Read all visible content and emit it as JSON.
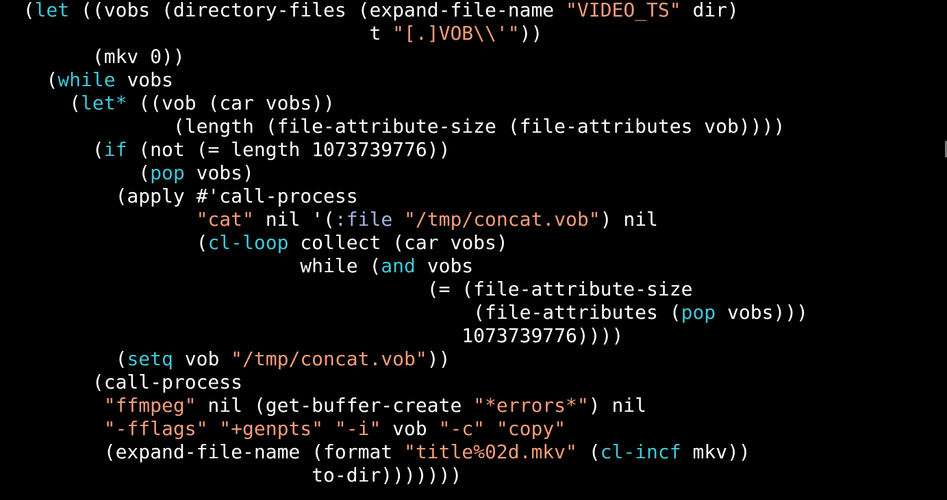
{
  "editor": {
    "lines": [
      [
        {
          "t": "  ",
          "c": "text"
        },
        {
          "t": "(",
          "c": "text"
        },
        {
          "t": "let",
          "c": "kw"
        },
        {
          "t": " ((vobs (directory-files (expand-file-name ",
          "c": "text"
        },
        {
          "t": "\"VIDEO_TS\"",
          "c": "str"
        },
        {
          "t": " dir)",
          "c": "text"
        }
      ],
      [
        {
          "t": "                                t ",
          "c": "text"
        },
        {
          "t": "\"[.]VOB\\\\'\"",
          "c": "str"
        },
        {
          "t": "))",
          "c": "text"
        }
      ],
      [
        {
          "t": "        (mkv 0))",
          "c": "text"
        }
      ],
      [
        {
          "t": "    (",
          "c": "text"
        },
        {
          "t": "while",
          "c": "kw"
        },
        {
          "t": " vobs",
          "c": "text"
        }
      ],
      [
        {
          "t": "      (",
          "c": "text"
        },
        {
          "t": "let*",
          "c": "kw"
        },
        {
          "t": " ((vob (car vobs))",
          "c": "text"
        }
      ],
      [
        {
          "t": "               (length (file-attribute-size (file-attributes vob))))",
          "c": "text"
        }
      ],
      [
        {
          "t": "        (",
          "c": "text"
        },
        {
          "t": "if",
          "c": "kw"
        },
        {
          "t": " (not (= length 1073739776))",
          "c": "text"
        }
      ],
      [
        {
          "t": "            (",
          "c": "text"
        },
        {
          "t": "pop",
          "c": "kw"
        },
        {
          "t": " vobs)",
          "c": "text"
        }
      ],
      [
        {
          "t": "          (apply #'call-process",
          "c": "text"
        }
      ],
      [
        {
          "t": "                 ",
          "c": "text"
        },
        {
          "t": "\"cat\"",
          "c": "str"
        },
        {
          "t": " nil '(",
          "c": "text"
        },
        {
          "t": ":file",
          "c": "key"
        },
        {
          "t": " ",
          "c": "text"
        },
        {
          "t": "\"/tmp/concat.vob\"",
          "c": "str"
        },
        {
          "t": ") nil",
          "c": "text"
        }
      ],
      [
        {
          "t": "                 (",
          "c": "text"
        },
        {
          "t": "cl-loop",
          "c": "kw"
        },
        {
          "t": " collect (car vobs)",
          "c": "text"
        }
      ],
      [
        {
          "t": "                          while (",
          "c": "text"
        },
        {
          "t": "and",
          "c": "kw"
        },
        {
          "t": " vobs",
          "c": "text"
        }
      ],
      [
        {
          "t": "                                     (= (file-attribute-size",
          "c": "text"
        }
      ],
      [
        {
          "t": "                                         (file-attributes (",
          "c": "text"
        },
        {
          "t": "pop",
          "c": "kw"
        },
        {
          "t": " vobs)))",
          "c": "text"
        }
      ],
      [
        {
          "t": "                                        1073739776))))",
          "c": "text"
        }
      ],
      [
        {
          "t": "          (",
          "c": "text"
        },
        {
          "t": "setq",
          "c": "kw"
        },
        {
          "t": " vob ",
          "c": "text"
        },
        {
          "t": "\"/tmp/concat.vob\"",
          "c": "str"
        },
        {
          "t": "))",
          "c": "text"
        }
      ],
      [
        {
          "t": "        (call-process",
          "c": "text"
        }
      ],
      [
        {
          "t": "         ",
          "c": "text"
        },
        {
          "t": "\"ffmpeg\"",
          "c": "str"
        },
        {
          "t": " nil (get-buffer-create ",
          "c": "text"
        },
        {
          "t": "\"*errors*\"",
          "c": "str"
        },
        {
          "t": ") nil",
          "c": "text"
        }
      ],
      [
        {
          "t": "         ",
          "c": "text"
        },
        {
          "t": "\"-fflags\"",
          "c": "str"
        },
        {
          "t": " ",
          "c": "text"
        },
        {
          "t": "\"+genpts\"",
          "c": "str"
        },
        {
          "t": " ",
          "c": "text"
        },
        {
          "t": "\"-i\"",
          "c": "str"
        },
        {
          "t": " vob ",
          "c": "text"
        },
        {
          "t": "\"-c\"",
          "c": "str"
        },
        {
          "t": " ",
          "c": "text"
        },
        {
          "t": "\"copy\"",
          "c": "str"
        }
      ],
      [
        {
          "t": "         (expand-file-name (format ",
          "c": "text"
        },
        {
          "t": "\"title%02d.mkv\"",
          "c": "str"
        },
        {
          "t": " (",
          "c": "text"
        },
        {
          "t": "cl-incf",
          "c": "kw"
        },
        {
          "t": " mkv))",
          "c": "text"
        }
      ],
      [
        {
          "t": "                           to-dir)))))))",
          "c": "text"
        }
      ]
    ]
  },
  "colors": {
    "background": "#000000",
    "default": "#ffffff",
    "keyword": "#40c8d8",
    "string": "#f49d7a",
    "keyword_symbol": "#9fb6dc"
  }
}
